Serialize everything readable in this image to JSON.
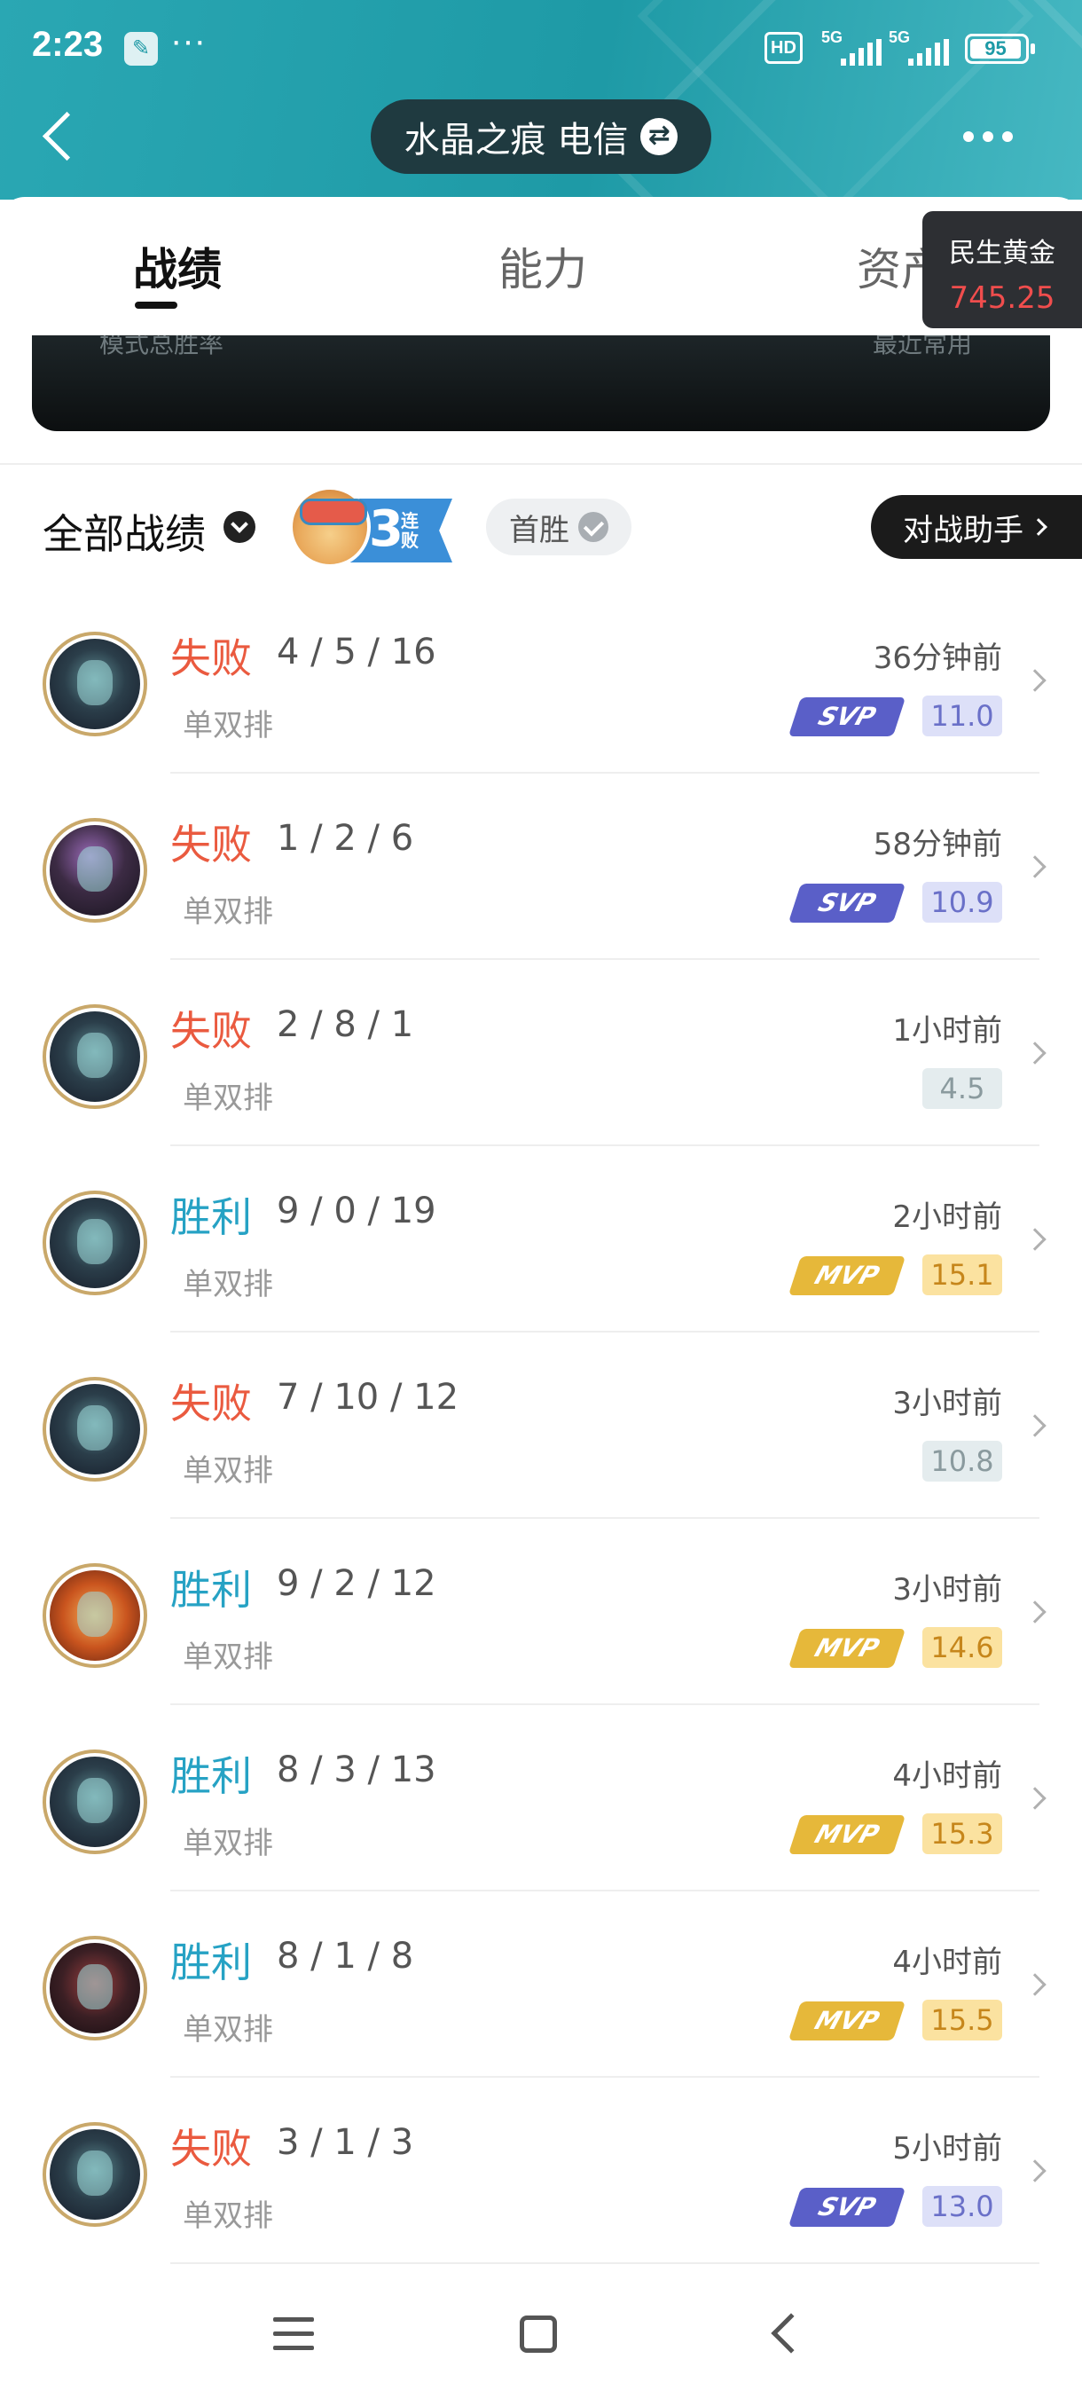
{
  "status_bar": {
    "time": "2:23",
    "dots": "···",
    "hd_label": "HD",
    "signal_label": "5G",
    "battery": "95"
  },
  "header": {
    "server_name": "水晶之痕 电信",
    "swap_icon": "⇄"
  },
  "tabs": [
    {
      "label": "战绩",
      "active": true
    },
    {
      "label": "能力",
      "active": false
    },
    {
      "label": "资产",
      "active": false
    }
  ],
  "stock_widget": {
    "name": "民生黄金",
    "price": "745.25",
    "price_color": "#f04d4d"
  },
  "banner": {
    "left_text": "模式总胜率",
    "right_text": "最近常用"
  },
  "filter": {
    "title": "全部战绩",
    "streak_number": "3",
    "streak_text": "连败",
    "first_win_label": "首胜",
    "assistant_label": "对战助手"
  },
  "colors": {
    "loss": "#ea5a3f",
    "win": "#26a2c4",
    "svp": "#5a5fc8",
    "mvp": "#e6b83a",
    "svp_score_bg": "#dde0f8",
    "svp_score_fg": "#6a70c8",
    "mvp_score_bg": "#fbe2a0",
    "mvp_score_fg": "#c6861b",
    "plain_score_bg": "#e4ecee",
    "plain_score_fg": "#8a9a9e"
  },
  "matches": [
    {
      "result": "失败",
      "outcome": "loss",
      "kda": "4 / 5 / 16",
      "mode": "单双排",
      "time": "36分钟前",
      "badge": "SVP",
      "score": "11.0",
      "champion_icon": "champion-avatar-teal"
    },
    {
      "result": "失败",
      "outcome": "loss",
      "kda": "1 / 2 / 6",
      "mode": "单双排",
      "time": "58分钟前",
      "badge": "SVP",
      "score": "10.9",
      "champion_icon": "champion-avatar-purple"
    },
    {
      "result": "失败",
      "outcome": "loss",
      "kda": "2 / 8 / 1",
      "mode": "单双排",
      "time": "1小时前",
      "badge": "",
      "score": "4.5",
      "champion_icon": "champion-avatar-teal"
    },
    {
      "result": "胜利",
      "outcome": "win",
      "kda": "9 / 0 / 19",
      "mode": "单双排",
      "time": "2小时前",
      "badge": "MVP",
      "score": "15.1",
      "champion_icon": "champion-avatar-teal"
    },
    {
      "result": "失败",
      "outcome": "loss",
      "kda": "7 / 10 / 12",
      "mode": "单双排",
      "time": "3小时前",
      "badge": "",
      "score": "10.8",
      "champion_icon": "champion-avatar-teal"
    },
    {
      "result": "胜利",
      "outcome": "win",
      "kda": "9 / 2 / 12",
      "mode": "单双排",
      "time": "3小时前",
      "badge": "MVP",
      "score": "14.6",
      "champion_icon": "champion-avatar-orange"
    },
    {
      "result": "胜利",
      "outcome": "win",
      "kda": "8 / 3 / 13",
      "mode": "单双排",
      "time": "4小时前",
      "badge": "MVP",
      "score": "15.3",
      "champion_icon": "champion-avatar-teal"
    },
    {
      "result": "胜利",
      "outcome": "win",
      "kda": "8 / 1 / 8",
      "mode": "单双排",
      "time": "4小时前",
      "badge": "MVP",
      "score": "15.5",
      "champion_icon": "champion-avatar-red"
    },
    {
      "result": "失败",
      "outcome": "loss",
      "kda": "3 / 1 / 3",
      "mode": "单双排",
      "time": "5小时前",
      "badge": "SVP",
      "score": "13.0",
      "champion_icon": "champion-avatar-teal"
    }
  ]
}
